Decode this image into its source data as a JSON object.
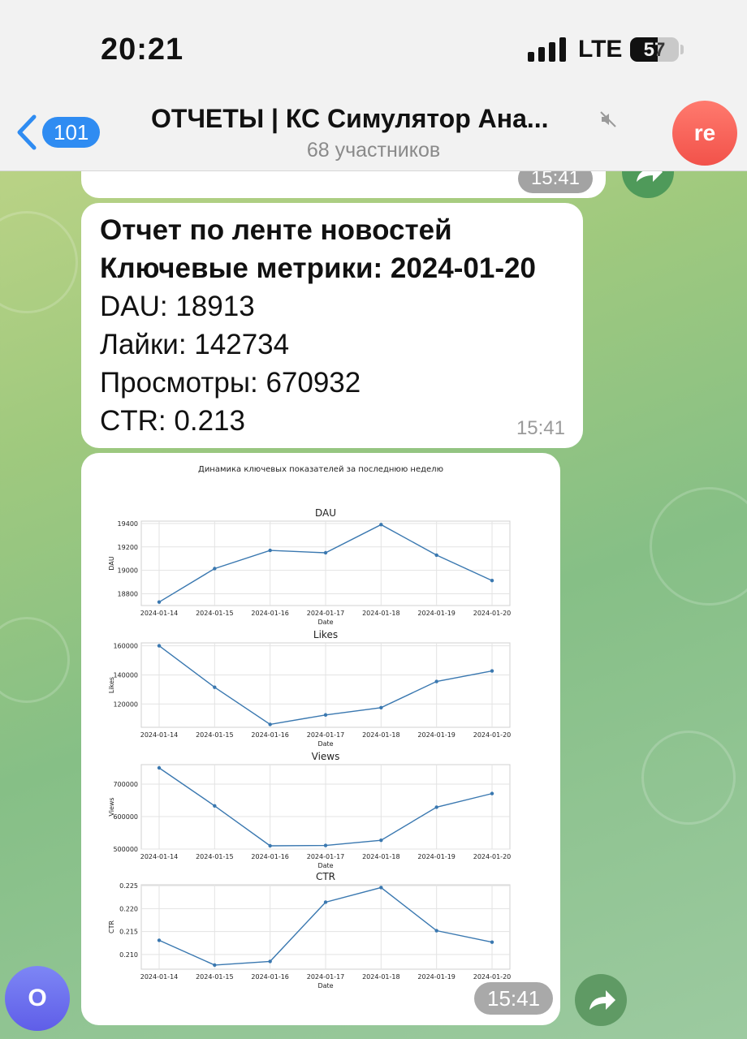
{
  "status_bar": {
    "time": "20:21",
    "network": "LTE",
    "battery": "57",
    "battery_level": 0.57
  },
  "header": {
    "back_badge": "101",
    "title": "ОТЧЕТЫ | КС Симулятор Ана...",
    "subtitle": "68 участников",
    "avatar_initials": "re"
  },
  "messages": {
    "previous": {
      "time": "15:41"
    },
    "report": {
      "lines": [
        "Отчет по ленте новостей",
        "Ключевые метрики: 2024-01-20",
        "DAU: 18913",
        "Лайки: 142734",
        "Просмотры: 670932",
        "CTR: 0.213"
      ],
      "time": "15:41"
    },
    "chart_message": {
      "time": "15:41"
    }
  },
  "user_avatar": {
    "initial": "О"
  },
  "icons": [
    "chevron-left-icon",
    "mute-icon",
    "forward-icon"
  ],
  "colors": {
    "line": "#3a78b0",
    "accent_blue": "#2f8cf2"
  },
  "chart_data": {
    "title": "Динамика ключевых показателей за последнюю неделю",
    "type": "line",
    "x": [
      "2024-01-14",
      "2024-01-15",
      "2024-01-16",
      "2024-01-17",
      "2024-01-18",
      "2024-01-19",
      "2024-01-20"
    ],
    "xlabel": "Date",
    "grid": true,
    "subplots": [
      {
        "title": "DAU",
        "ylabel": "DAU",
        "values": [
          18730,
          19015,
          19170,
          19150,
          19390,
          19130,
          18913
        ],
        "ylim": [
          18700,
          19420
        ],
        "yticks": [
          18800,
          19000,
          19200,
          19400
        ]
      },
      {
        "title": "Likes",
        "ylabel": "Likes",
        "values": [
          160000,
          131500,
          106000,
          112500,
          117500,
          135500,
          142734
        ],
        "ylim": [
          104000,
          162000
        ],
        "yticks": [
          120000,
          140000,
          160000
        ]
      },
      {
        "title": "Views",
        "ylabel": "Views",
        "values": [
          750000,
          633000,
          510000,
          511000,
          527000,
          629000,
          670932
        ],
        "ylim": [
          500000,
          760000
        ],
        "yticks": [
          500000,
          600000,
          700000
        ]
      },
      {
        "title": "CTR",
        "ylabel": "CTR",
        "values": [
          0.2131,
          0.2077,
          0.2085,
          0.2214,
          0.2246,
          0.2152,
          0.2127
        ],
        "ylim": [
          0.2068,
          0.2252
        ],
        "yticks": [
          0.21,
          0.215,
          0.22,
          0.225
        ]
      }
    ]
  }
}
